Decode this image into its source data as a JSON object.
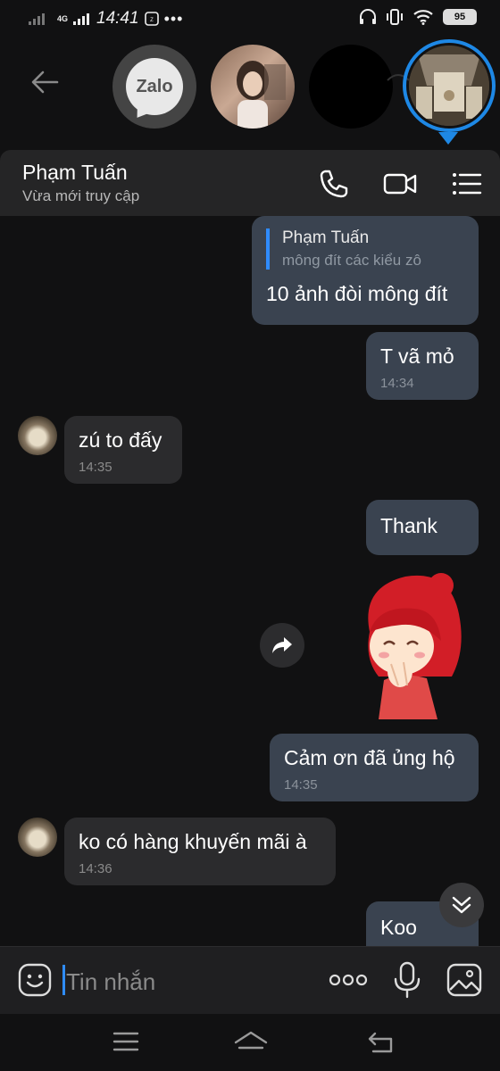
{
  "status_bar": {
    "network": "4G",
    "time": "14:41",
    "dots": "•••",
    "battery": "95"
  },
  "chat_heads": {
    "zalo_label": "Zalo"
  },
  "header": {
    "name": "Phạm Tuấn",
    "status": "Vừa mới truy cập"
  },
  "messages": [
    {
      "quote_name": "Phạm Tuấn",
      "quote_text": "mông đít các kiểu zô",
      "text": "10 ảnh đòi mông đít"
    },
    {
      "text": "T vã mỏ",
      "time": "14:34"
    },
    {
      "text": "zú to đấy",
      "time": "14:35"
    },
    {
      "text": "Thank"
    },
    {
      "text": "Cảm ơn đã ủng hộ",
      "time": "14:35"
    },
    {
      "text": "ko có hàng khuyến mãi à",
      "time": "14:36"
    },
    {
      "text": "Koo"
    }
  ],
  "input": {
    "placeholder": "Tin nhắn",
    "more": "ooo"
  },
  "colors": {
    "accent": "#1e88e5",
    "outgoing_bubble": "#3a4350",
    "incoming_bubble": "#2b2b2d",
    "background": "#111112"
  }
}
